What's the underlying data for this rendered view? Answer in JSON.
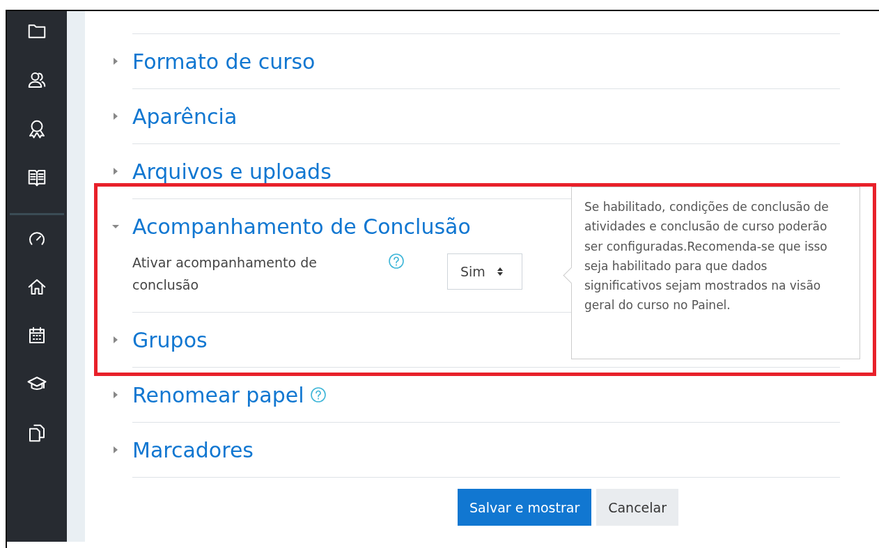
{
  "sections": [
    {
      "title": "Formato de curso",
      "expanded": false
    },
    {
      "title": "Aparência",
      "expanded": false
    },
    {
      "title": "Arquivos e uploads",
      "expanded": false
    },
    {
      "title": "Acompanhamento de Conclusão",
      "expanded": true,
      "fields": [
        {
          "label": "Ativar acompanhamento de conclusão",
          "help": true,
          "value": "Sim"
        }
      ]
    },
    {
      "title": "Grupos",
      "expanded": false
    },
    {
      "title": "Renomear papel",
      "expanded": false,
      "help": true
    },
    {
      "title": "Marcadores",
      "expanded": false
    }
  ],
  "tooltip": {
    "text": "Se habilitado, condições de conclusão de atividades e conclusão de curso poderão ser configuradas.Recomenda-se que isso seja habilitado para que dados significativos sejam mostrados na visão geral do curso no Painel."
  },
  "buttons": [
    {
      "label": "Salvar e mostrar",
      "kind": "primary"
    },
    {
      "label": "Cancelar",
      "kind": "secondary"
    }
  ]
}
